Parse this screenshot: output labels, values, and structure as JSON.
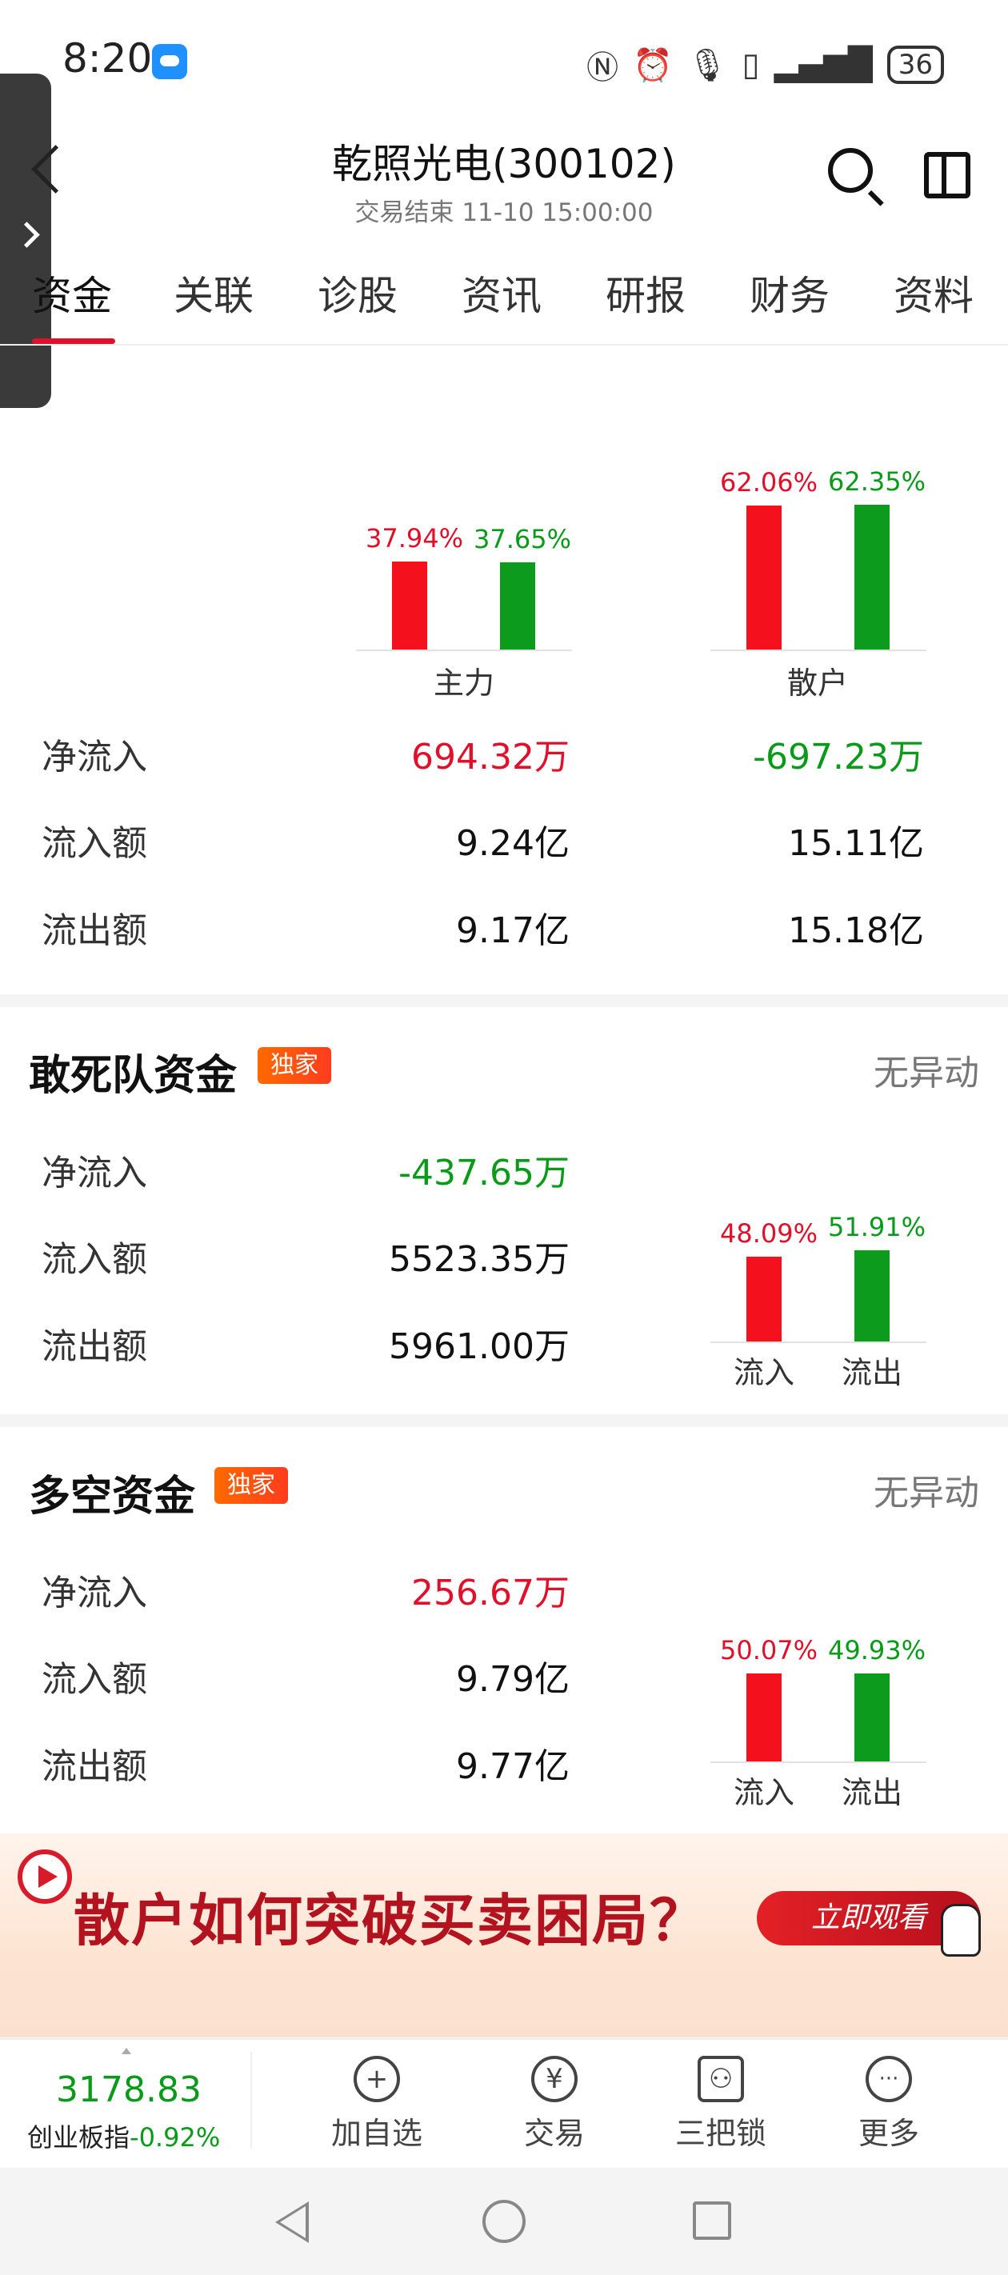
{
  "status_bar": {
    "time": "8:20",
    "battery": "36"
  },
  "header": {
    "title": "乾照光电(300102)",
    "subtitle": "交易结束 11-10 15:00:00"
  },
  "tabs": [
    "资金",
    "关联",
    "诊股",
    "资讯",
    "研报",
    "财务",
    "资料"
  ],
  "overview": {
    "groups": [
      {
        "name": "主力",
        "inflow_pct": "37.94%",
        "outflow_pct": "37.65%",
        "inflow_ratio": 0.3794,
        "outflow_ratio": 0.3765
      },
      {
        "name": "散户",
        "inflow_pct": "62.06%",
        "outflow_pct": "62.35%",
        "inflow_ratio": 0.6206,
        "outflow_ratio": 0.6235
      }
    ],
    "rows": [
      {
        "label": "净流入",
        "main": "694.32万",
        "retail": "-697.23万"
      },
      {
        "label": "流入额",
        "main": "9.24亿",
        "retail": "15.11亿"
      },
      {
        "label": "流出额",
        "main": "9.17亿",
        "retail": "15.18亿"
      }
    ]
  },
  "dare_squad": {
    "title": "敢死队资金",
    "badge": "独家",
    "status": "无异动",
    "rows": [
      {
        "label": "净流入",
        "value": "-437.65万"
      },
      {
        "label": "流入额",
        "value": "5523.35万"
      },
      {
        "label": "流出额",
        "value": "5961.00万"
      }
    ],
    "in_pct": "48.09%",
    "out_pct": "51.91%",
    "in_ratio": 0.4809,
    "out_ratio": 0.5191,
    "in_label": "流入",
    "out_label": "流出"
  },
  "long_short": {
    "title": "多空资金",
    "badge": "独家",
    "status": "无异动",
    "rows": [
      {
        "label": "净流入",
        "value": "256.67万"
      },
      {
        "label": "流入额",
        "value": "9.79亿"
      },
      {
        "label": "流出额",
        "value": "9.77亿"
      }
    ],
    "in_pct": "50.07%",
    "out_pct": "49.93%",
    "in_ratio": 0.5007,
    "out_ratio": 0.4993,
    "in_label": "流入",
    "out_label": "流出"
  },
  "banner": {
    "text": "散户如何突破买卖困局？",
    "button": "立即观看"
  },
  "bottom_nav": {
    "index_value": "3178.83",
    "index_name": "创业板指",
    "index_change": "-0.92%",
    "items": [
      {
        "label": "加自选",
        "icon": "plus-circle-icon",
        "glyph": "+"
      },
      {
        "label": "交易",
        "icon": "yen-circle-icon",
        "glyph": "¥"
      },
      {
        "label": "三把锁",
        "icon": "lock-trio-icon",
        "glyph": "⚇"
      },
      {
        "label": "更多",
        "icon": "more-dots-icon",
        "glyph": "···"
      }
    ]
  },
  "colors": {
    "up": "#e0102a",
    "down": "#0a9a1a",
    "accent": "#e0102a"
  }
}
